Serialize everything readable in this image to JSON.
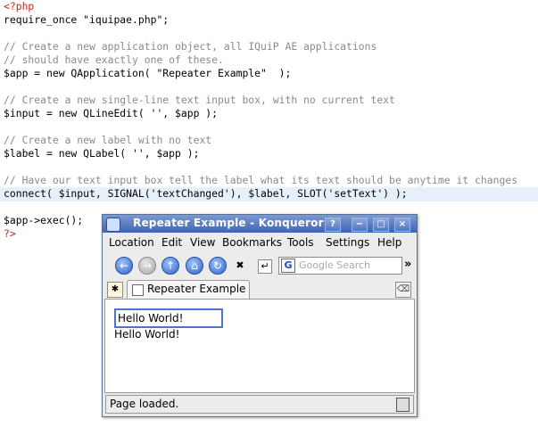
{
  "code_lines": [
    "<?php",
    "require_once \"iquipae.php\";",
    "",
    "// Create a new application object, all IQuiP AE applications",
    "// should have exactly one of these.",
    "$app = new QApplication( \"Repeater Example\"  );",
    "",
    "// Create a new single-line text input box, with no current text",
    "$input = new QLineEdit( '', $app );",
    "",
    "// Create a new label with no text",
    "$label = new QLabel( '', $app );",
    "",
    "// Have our text input box tell the label what its text should be anytime it changes",
    "connect( $input, SIGNAL('textChanged'), $label, SLOT('setText') );",
    "",
    "$app->exec();",
    "?>"
  ],
  "window": {
    "title": "Repeater Example - Konqueror",
    "buttons": {
      "help": "?",
      "minimize": "−",
      "maximize": "□",
      "close": "×"
    },
    "menu": [
      "Location",
      "Edit",
      "View",
      "Bookmarks",
      "Tools",
      "Settings",
      "Help"
    ],
    "toolbar": {
      "search_placeholder": "Google Search",
      "overflow": "»"
    },
    "tab_label": "Repeater Example",
    "content": {
      "input_value": "Hello World!",
      "label_text": "Hello World!"
    },
    "status": "Page loaded."
  },
  "colors": {
    "code_comment": "#8a8a8a",
    "code_variable": "#c4261f",
    "code_string": "#2e7a2a",
    "titlebar": "#3f65b3",
    "current_line": "#e6f0fb"
  }
}
